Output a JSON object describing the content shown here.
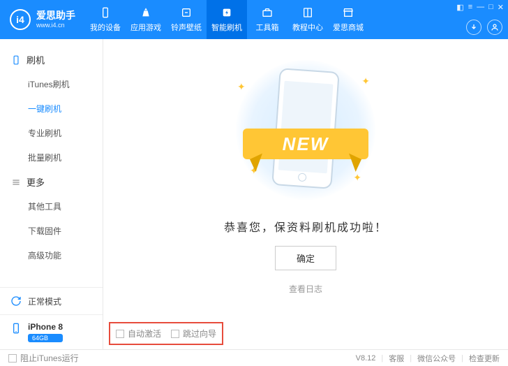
{
  "brand": {
    "name": "爱思助手",
    "url": "www.i4.cn",
    "logo_text": "i4"
  },
  "nav": [
    {
      "label": "我的设备",
      "icon": "phone-icon"
    },
    {
      "label": "应用游戏",
      "icon": "apps-icon"
    },
    {
      "label": "铃声壁纸",
      "icon": "music-icon"
    },
    {
      "label": "智能刷机",
      "icon": "flash-icon",
      "active": true
    },
    {
      "label": "工具箱",
      "icon": "toolbox-icon"
    },
    {
      "label": "教程中心",
      "icon": "book-icon"
    },
    {
      "label": "爱思商城",
      "icon": "store-icon"
    }
  ],
  "sidebar": {
    "sections": [
      {
        "title": "刷机",
        "icon": "device-icon",
        "items": [
          {
            "label": "iTunes刷机"
          },
          {
            "label": "一键刷机",
            "active": true
          },
          {
            "label": "专业刷机"
          },
          {
            "label": "批量刷机"
          }
        ]
      },
      {
        "title": "更多",
        "icon": "more-icon",
        "items": [
          {
            "label": "其他工具"
          },
          {
            "label": "下载固件"
          },
          {
            "label": "高级功能"
          }
        ]
      }
    ],
    "mode": {
      "label": "正常模式"
    },
    "device": {
      "name": "iPhone 8",
      "storage": "64GB"
    }
  },
  "content": {
    "ribbon": "NEW",
    "message": "恭喜您，保资料刷机成功啦！",
    "ok": "确定",
    "log": "查看日志",
    "options": {
      "auto_activate": "自动激活",
      "skip_guide": "跳过向导"
    }
  },
  "status": {
    "block_itunes": "阻止iTunes运行",
    "version": "V8.12",
    "support": "客服",
    "wechat": "微信公众号",
    "update": "检查更新"
  }
}
